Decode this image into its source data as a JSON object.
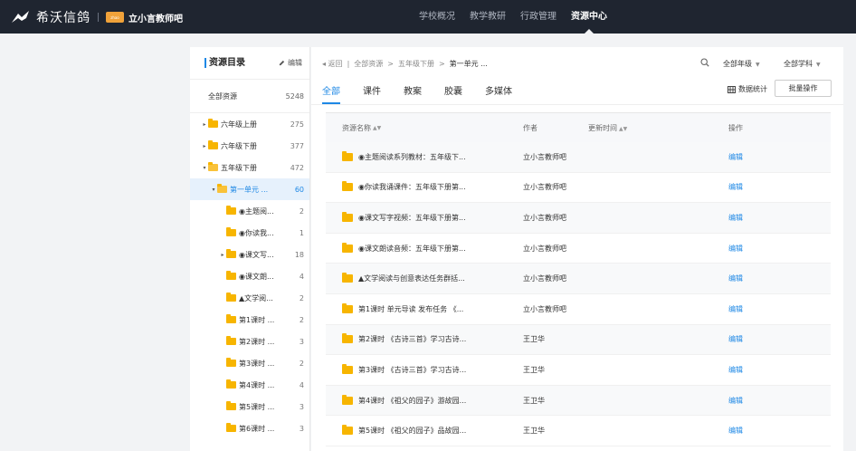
{
  "topbar": {
    "brand_name": "希沃信鸽",
    "school_badge": "zhao",
    "school_name": "立小言教师吧",
    "nav": [
      {
        "label": "学校概况",
        "active": false
      },
      {
        "label": "教学教研",
        "active": false
      },
      {
        "label": "行政管理",
        "active": false
      },
      {
        "label": "资源中心",
        "active": true
      }
    ]
  },
  "tree": {
    "title": "资源目录",
    "edit_label": "编辑",
    "all": {
      "label": "全部资源",
      "count": "5248"
    },
    "rows": [
      {
        "label": "六年级上册",
        "count": "275",
        "arrow": "▸",
        "level": 0
      },
      {
        "label": "六年级下册",
        "count": "377",
        "arrow": "▸",
        "level": 0
      },
      {
        "label": "五年级下册",
        "count": "472",
        "arrow": "▾",
        "level": 0
      },
      {
        "label": "第一单元 ...",
        "count": "60",
        "arrow": "▾",
        "level": 1,
        "selected": true
      },
      {
        "label": "◉主题阅...",
        "count": "2",
        "arrow": "",
        "level": 2
      },
      {
        "label": "◉你读我...",
        "count": "1",
        "arrow": "",
        "level": 2
      },
      {
        "label": "◉课文写...",
        "count": "18",
        "arrow": "▸",
        "level": 2
      },
      {
        "label": "◉课文朗...",
        "count": "4",
        "arrow": "",
        "level": 2
      },
      {
        "label": "▲文学阅...",
        "count": "2",
        "arrow": "",
        "level": 2
      },
      {
        "label": "第1课时 ...",
        "count": "2",
        "arrow": "",
        "level": 2
      },
      {
        "label": "第2课时 ...",
        "count": "3",
        "arrow": "",
        "level": 2
      },
      {
        "label": "第3课时 ...",
        "count": "2",
        "arrow": "",
        "level": 2
      },
      {
        "label": "第4课时 ...",
        "count": "4",
        "arrow": "",
        "level": 2
      },
      {
        "label": "第5课时 ...",
        "count": "3",
        "arrow": "",
        "level": 2
      },
      {
        "label": "第6课时 ...",
        "count": "3",
        "arrow": "",
        "level": 2
      }
    ]
  },
  "main": {
    "breadcrumb": {
      "back": "◂ 返回",
      "sep": "|",
      "items": [
        "全部资源",
        ">",
        "五年级下册",
        ">"
      ],
      "current": "第一单元 ..."
    },
    "grade_dropdown": "全部年级",
    "subject_dropdown": "全部学科",
    "tabs": [
      {
        "label": "全部",
        "active": true
      },
      {
        "label": "课件",
        "active": false
      },
      {
        "label": "教案",
        "active": false
      },
      {
        "label": "胶囊",
        "active": false
      },
      {
        "label": "多媒体",
        "active": false
      }
    ],
    "stats_label": "数据统计",
    "batch_label": "批量操作",
    "table": {
      "headers": {
        "name": "资源名称",
        "author": "作者",
        "time": "更新时间",
        "op": "操作"
      },
      "rows": [
        {
          "name": "◉主题阅读系列教材：五年级下...",
          "author": "立小言教师吧",
          "time": "",
          "op": "编辑"
        },
        {
          "name": "◉你读我诵课件：五年级下册第...",
          "author": "立小言教师吧",
          "time": "",
          "op": "编辑"
        },
        {
          "name": "◉课文写字视频：五年级下册第...",
          "author": "立小言教师吧",
          "time": "",
          "op": "编辑"
        },
        {
          "name": "◉课文朗读音频：五年级下册第...",
          "author": "立小言教师吧",
          "time": "",
          "op": "编辑"
        },
        {
          "name": "▲文学阅读与创意表达任务群括...",
          "author": "立小言教师吧",
          "time": "",
          "op": "编辑"
        },
        {
          "name": "第1课时 单元导读 发布任务 《...",
          "author": "立小言教师吧",
          "time": "",
          "op": "编辑"
        },
        {
          "name": "第2课时 《古诗三首》学习古诗...",
          "author": "王卫华",
          "time": "",
          "op": "编辑"
        },
        {
          "name": "第3课时 《古诗三首》学习古诗...",
          "author": "王卫华",
          "time": "",
          "op": "编辑"
        },
        {
          "name": "第4课时 《祖父的园子》游故园...",
          "author": "王卫华",
          "time": "",
          "op": "编辑"
        },
        {
          "name": "第5课时 《祖父的园子》品故园...",
          "author": "王卫华",
          "time": "",
          "op": "编辑"
        }
      ]
    }
  }
}
